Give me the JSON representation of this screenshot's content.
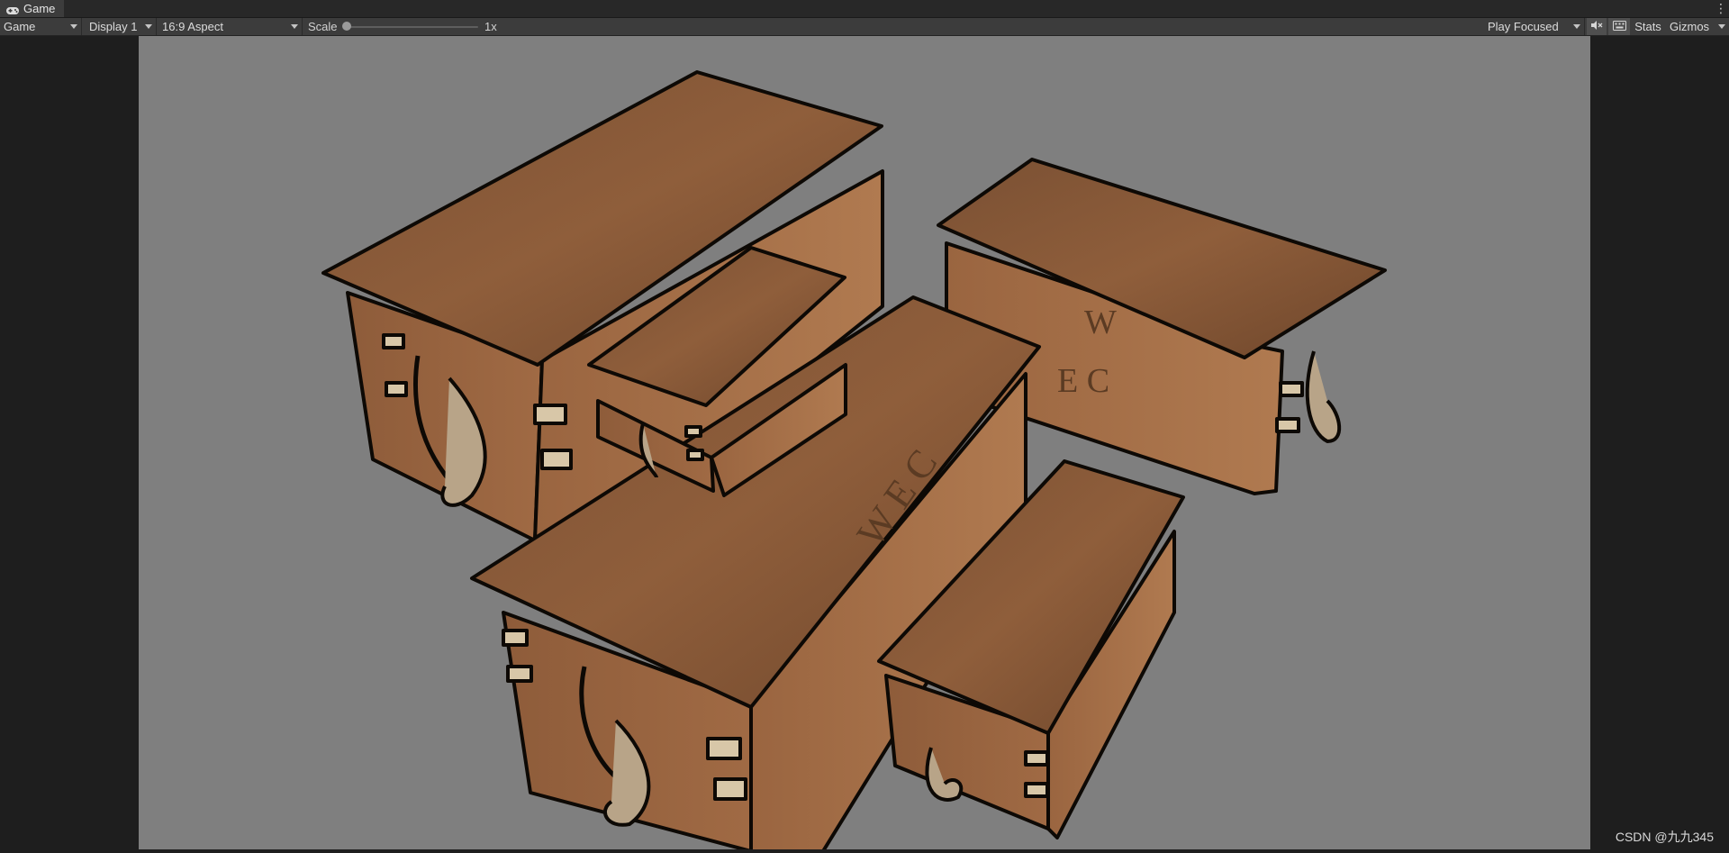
{
  "tab": {
    "title": "Game",
    "icon": "gamepad-icon"
  },
  "toolbar": {
    "mode": "Game",
    "display": "Display 1",
    "aspect": "16:9 Aspect",
    "scale_label": "Scale",
    "scale_value": "1x",
    "scale_fraction": 0.0,
    "play_mode": "Play Focused",
    "mute_icon": "mute-audio-icon",
    "shortcuts_icon": "keyboard-shortcuts-icon",
    "stats": "Stats",
    "gizmos": "Gizmos"
  },
  "viewport": {
    "background": "#7f7f7f",
    "wood_color": "#8a5a36",
    "outline_color": "#0d0905",
    "crate_marking": "W E C"
  },
  "watermark": "CSDN @九九345"
}
